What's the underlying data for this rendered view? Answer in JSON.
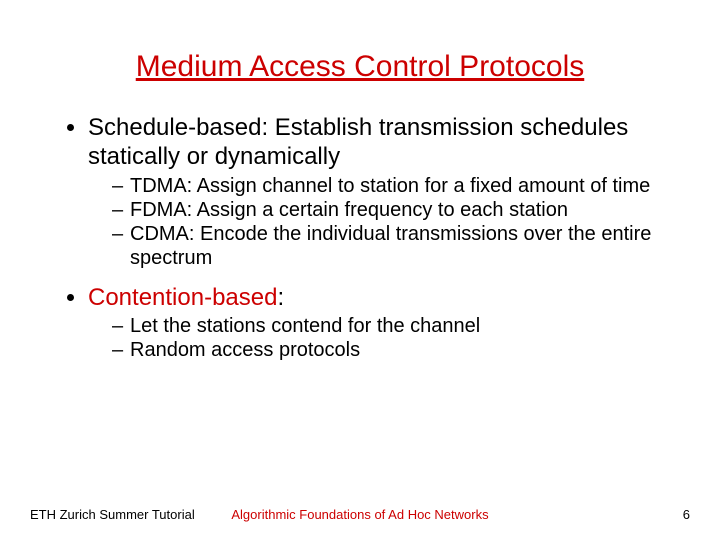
{
  "title": "Medium Access Control Protocols",
  "bullets": {
    "b1": {
      "text": "Schedule-based: Establish transmission schedules statically or dynamically",
      "sub": {
        "s1": "TDMA: Assign channel to station for a fixed amount of time",
        "s2": "FDMA: Assign a certain frequency to each station",
        "s3": "CDMA: Encode the individual transmissions over the entire spectrum"
      }
    },
    "b2": {
      "label": "Contention-based",
      "colon": ":",
      "sub": {
        "s1": "Let the stations contend for the channel",
        "s2": "Random access protocols"
      }
    }
  },
  "footer": {
    "left": "ETH Zurich Summer Tutorial",
    "center": "Algorithmic Foundations of Ad Hoc Networks",
    "right": "6"
  }
}
